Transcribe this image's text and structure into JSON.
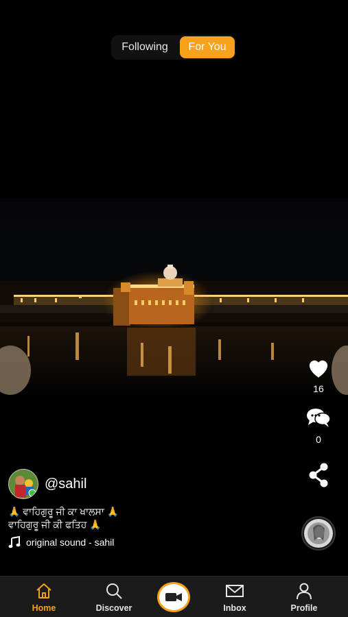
{
  "top_tabs": {
    "following": "Following",
    "for_you": "For You",
    "active": "For You"
  },
  "actions": {
    "likes": "16",
    "comments": "0"
  },
  "post": {
    "username": "@sahil",
    "caption": "🙏 ਵਾਹਿਗੁਰੂ ਜੀ ਕਾ ਖਾਲਸਾ 🙏\nਵਾਹਿਗੁਰੂ ਜੀ ਕੀ ਫਤਿਹ 🙏",
    "sound": "original sound - sahil"
  },
  "bottom_nav": {
    "home": "Home",
    "discover": "Discover",
    "inbox": "Inbox",
    "profile": "Profile",
    "active": "Home"
  },
  "colors": {
    "accent": "#f7a21b",
    "background": "#000000",
    "tabbar": "#1b1b1b"
  },
  "icons": [
    "heart-icon",
    "comment-icon",
    "share-icon",
    "music-note-icon",
    "home-icon",
    "search-icon",
    "video-camera-icon",
    "mail-icon",
    "person-icon"
  ]
}
